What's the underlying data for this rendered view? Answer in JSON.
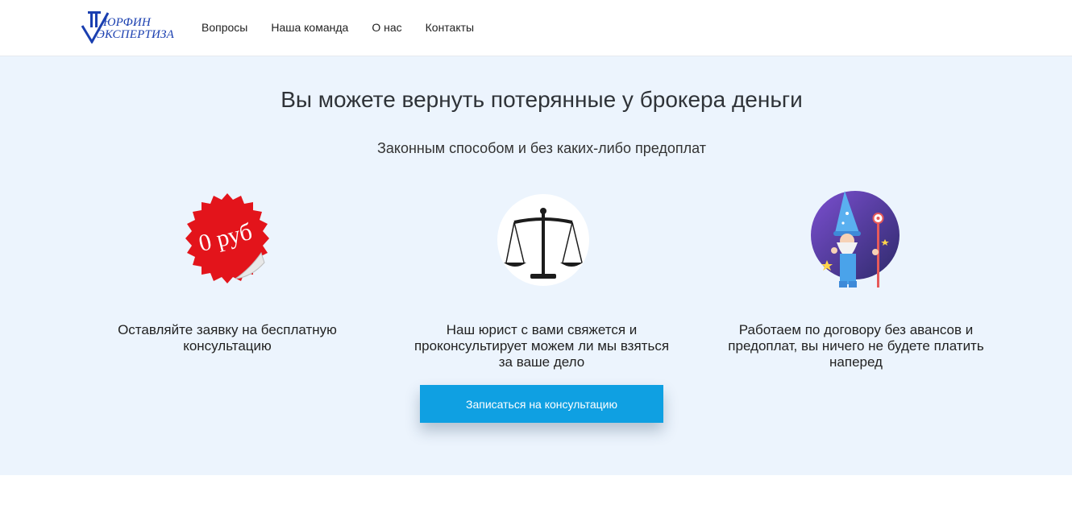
{
  "brand": {
    "logo_line1": "ЮРФИН",
    "logo_line2": "ЭКСПЕРТИЗА",
    "color": "#1a3fb0"
  },
  "nav": {
    "items": [
      "Вопросы",
      "Наша команда",
      "О нас",
      "Контакты"
    ]
  },
  "hero": {
    "title": "Вы можете вернуть потерянные у брокера деньги",
    "subtitle": "Законным способом и без каких-либо предоплат",
    "background": "#ecf4fd"
  },
  "features": [
    {
      "icon": "zero-rub-sticker-icon",
      "sticker_text": "0 руб",
      "text": "Оставляйте заявку на бесплатную консультацию"
    },
    {
      "icon": "scales-of-justice-icon",
      "text": "Наш юрист с вами свяжется и проконсультирует можем ли мы взяться за ваше дело"
    },
    {
      "icon": "wizard-icon",
      "text": "Работаем по договору без авансов и предоплат, вы ничего не будете платить наперед"
    }
  ],
  "cta": {
    "label": "Записаться на консультацию",
    "color": "#0fa0e2"
  }
}
